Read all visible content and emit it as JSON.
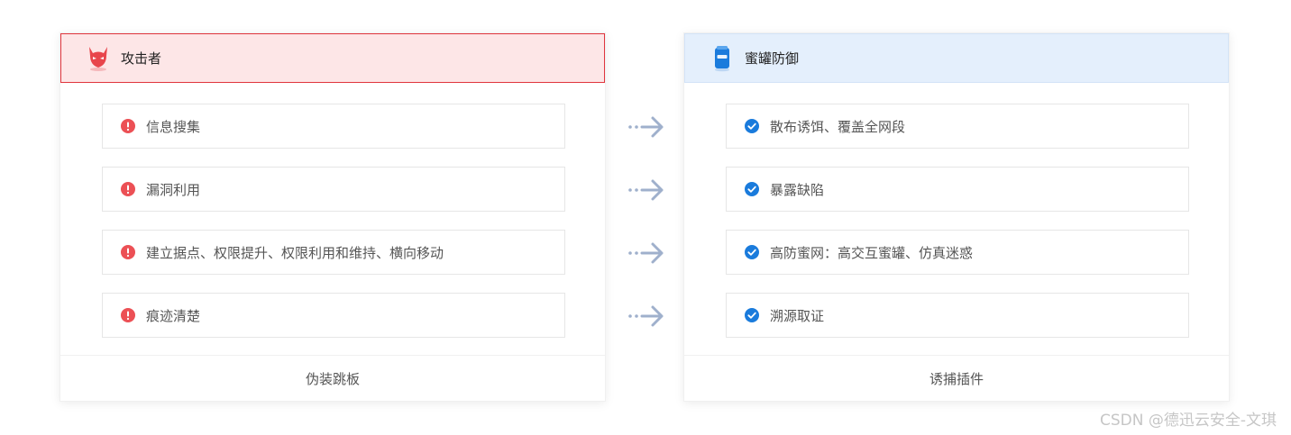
{
  "attacker": {
    "title": "攻击者",
    "icon": "devil-mask-icon",
    "items": [
      {
        "label": "信息搜集"
      },
      {
        "label": "漏洞利用"
      },
      {
        "label": "建立据点、权限提升、权限利用和维持、横向移动"
      },
      {
        "label": "痕迹清楚"
      }
    ],
    "footer": "伪装跳板",
    "item_icon": "alert-circle-icon",
    "accent_color": "#e0353d"
  },
  "defense": {
    "title": "蜜罐防御",
    "icon": "honeypot-jar-icon",
    "items": [
      {
        "label": "散布诱饵、覆盖全网段"
      },
      {
        "label": "暴露缺陷"
      },
      {
        "label": "高防蜜网：高交互蜜罐、仿真迷惑"
      },
      {
        "label": "溯源取证"
      }
    ],
    "footer": "诱捕插件",
    "item_icon": "check-circle-icon",
    "accent_color": "#1a7bdc"
  },
  "connector_icon": "dotted-arrow-right-icon",
  "watermark": "CSDN @德迅云安全-文琪"
}
